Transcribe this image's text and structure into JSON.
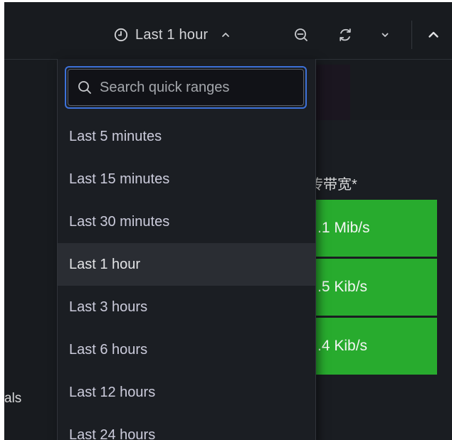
{
  "toolbar": {
    "time_range_label": "Last 1 hour",
    "icons": [
      "clock-icon",
      "chevron-up-icon",
      "zoom-out-icon",
      "refresh-icon",
      "chevron-down-icon",
      "collapse-icon"
    ]
  },
  "time_picker": {
    "search_placeholder": "Search quick ranges",
    "options": [
      "Last 5 minutes",
      "Last 15 minutes",
      "Last 30 minutes",
      "Last 1 hour",
      "Last 3 hours",
      "Last 6 hours",
      "Last 12 hours",
      "Last 24 hours"
    ],
    "selected": "Last 1 hour"
  },
  "panel": {
    "title_fragment": "传带宽*",
    "stats": [
      ".1 Mib/s",
      ".5 Kib/s",
      ".4 Kib/s"
    ]
  },
  "left_fragment": "als",
  "colors": {
    "background": "#181b1f",
    "accent_blue": "#3d71d9",
    "stat_green": "#28ab2e"
  }
}
